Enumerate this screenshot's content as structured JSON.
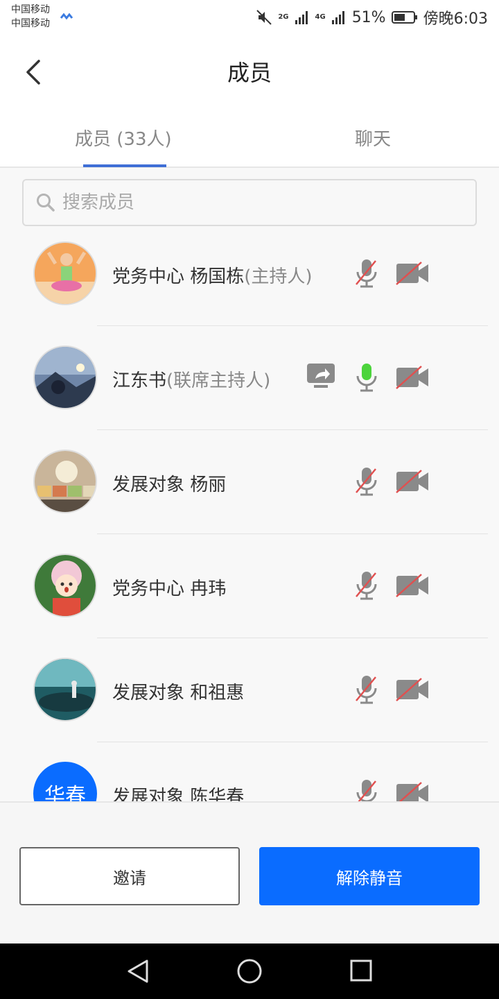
{
  "status_bar": {
    "carrier_1": "中国移动",
    "carrier_2": "中国移动",
    "net_2g": "2G",
    "net_4g": "4G",
    "battery": "51%",
    "time": "傍晚6:03"
  },
  "header": {
    "title": "成员"
  },
  "tabs": [
    {
      "label": "成员 (33人)",
      "active": true
    },
    {
      "label": "聊天",
      "active": false
    }
  ],
  "search": {
    "placeholder": "搜索成员"
  },
  "members": [
    {
      "name": "党务中心 杨国栋",
      "role": "(主持人)",
      "mic": "muted",
      "camera": "off",
      "sharing": false
    },
    {
      "name": "江东书",
      "role": "(联席主持人)",
      "mic": "active",
      "camera": "off",
      "sharing": true
    },
    {
      "name": " 发展对象 杨丽",
      "role": "",
      "mic": "muted",
      "camera": "off",
      "sharing": false
    },
    {
      "name": "党务中心  冉玮",
      "role": "",
      "mic": "muted",
      "camera": "off",
      "sharing": false
    },
    {
      "name": "发展对象   和祖惠",
      "role": "",
      "mic": "muted",
      "camera": "off",
      "sharing": false
    },
    {
      "name": "发展对象 陈华春",
      "role": "",
      "mic": "muted",
      "camera": "off",
      "sharing": false,
      "avatar_text": "华春"
    }
  ],
  "buttons": {
    "invite": "邀请",
    "unmute": "解除静音"
  },
  "colors": {
    "accent": "#0a6cff",
    "tab_indicator": "#3f6fd6",
    "mic_active": "#4cd43c",
    "muted_slash": "#e05050"
  }
}
